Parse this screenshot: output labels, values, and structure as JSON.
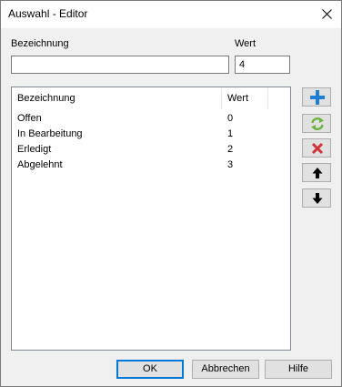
{
  "window": {
    "title": "Auswahl - Editor"
  },
  "form": {
    "name_label": "Bezeichnung",
    "name_value": "",
    "value_label": "Wert",
    "value_value": "4"
  },
  "list": {
    "columns": [
      "Bezeichnung",
      "Wert"
    ],
    "rows": [
      {
        "name": "Offen",
        "value": "0"
      },
      {
        "name": "In Bearbeitung",
        "value": "1"
      },
      {
        "name": "Erledigt",
        "value": "2"
      },
      {
        "name": "Abgelehnt",
        "value": "3"
      }
    ]
  },
  "side_buttons": [
    {
      "icon": "plus-icon",
      "color": "#1e7dd4"
    },
    {
      "icon": "refresh-icon",
      "color": "#6ab33e"
    },
    {
      "icon": "delete-icon",
      "color": "#d13438"
    },
    {
      "icon": "arrow-up-icon",
      "color": "#000000"
    },
    {
      "icon": "arrow-down-icon",
      "color": "#000000"
    }
  ],
  "footer": {
    "ok_label": "OK",
    "cancel_label": "Abbrechen",
    "help_label": "Hilfe"
  }
}
